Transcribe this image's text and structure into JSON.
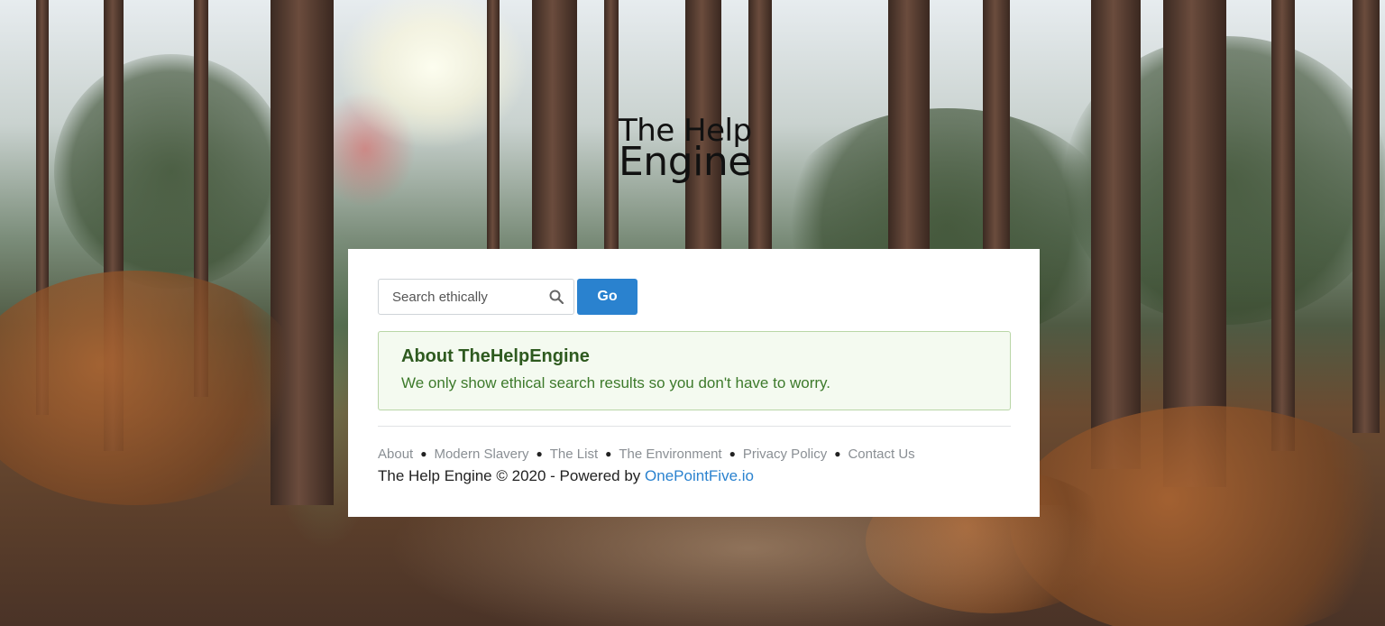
{
  "logo": {
    "line1": "The Help",
    "line2": "Engine"
  },
  "search": {
    "placeholder": "Search ethically",
    "value": "",
    "icon": "search-icon",
    "button_label": "Go",
    "button_color": "#2a82cf"
  },
  "about": {
    "title": "About TheHelpEngine",
    "text": "We only show ethical search results so you don't have to worry.",
    "title_color": "#2e5a1f",
    "text_color": "#3d7a2b",
    "background_color": "#f4faf0",
    "border_color": "#b9d6a7"
  },
  "footer": {
    "links": [
      {
        "label": "About"
      },
      {
        "label": "Modern Slavery"
      },
      {
        "label": "The List"
      },
      {
        "label": "The Environment"
      },
      {
        "label": "Privacy Policy"
      },
      {
        "label": "Contact Us"
      }
    ],
    "separator": "●",
    "copyright_prefix": "The Help Engine © 2020 - Powered by ",
    "powered_by_link": "OnePointFive.io",
    "link_color": "#2a82cf"
  }
}
